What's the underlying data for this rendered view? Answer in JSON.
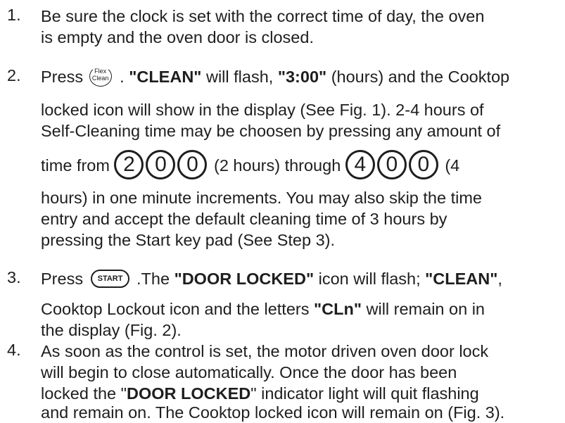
{
  "steps": [
    {
      "num": "1.",
      "l1": "Be sure the clock is set with the correct time of day, the oven",
      "l2": "is empty and the oven door is closed."
    },
    {
      "num": "2.",
      "press": "Press",
      "flex_top": "Flex",
      "flex_bottom": "Clean",
      "l1_dot": ".",
      "clean": "\"CLEAN\"",
      "will_flash": "will flash,",
      "three": "\"3:00\"",
      "l1_tail": "(hours) and the Cooktop",
      "l2": "locked icon will show in the display (See Fig. 1). 2-4 hours of",
      "l3": "Self-Cleaning time may be choosen by pressing any amount of",
      "time_from": "time from",
      "pad_a": [
        "2",
        "0",
        "0"
      ],
      "two_hours": "(2 hours) through",
      "pad_b": [
        "4",
        "0",
        "0"
      ],
      "four": "(4",
      "l5": "hours) in one minute increments. You may also skip the time",
      "l6": "entry and accept the default cleaning time of 3 hours by",
      "l7": "pressing the Start key pad (See Step 3)."
    },
    {
      "num": "3.",
      "press": "Press",
      "start_key": "START",
      "the": ".The",
      "door_locked": "\"DOOR LOCKED\"",
      "icon_flash": "icon will flash;",
      "clean": "\"CLEAN\"",
      "comma": ",",
      "l2_a": "Cooktop Lockout icon and the letters",
      "cln": "\"CLn\"",
      "l2_b": "will remain on in",
      "l3": "the display (Fig. 2)."
    },
    {
      "num": "4.",
      "l1": "As soon as the control is set, the motor driven oven door lock",
      "l2": "will begin to close automatically. Once the door has been",
      "l3_a": "locked the \"",
      "door_locked": "DOOR LOCKED",
      "l3_b": "\" indicator light will quit flashing",
      "l4": "and remain on. The Cooktop locked icon will remain on (Fig. 3)."
    }
  ]
}
